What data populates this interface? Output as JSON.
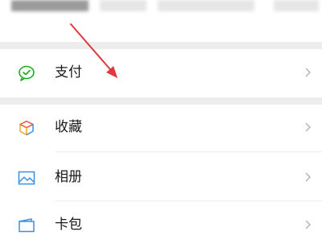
{
  "menu": {
    "items": [
      {
        "label": "支付",
        "icon": "wechat-pay-icon",
        "icon_color": "#1aad19"
      },
      {
        "label": "收藏",
        "icon": "favorites-cube-icon",
        "icon_colors": [
          "#f5a623",
          "#e84c3d",
          "#3b8ee6"
        ]
      },
      {
        "label": "相册",
        "icon": "album-image-icon",
        "icon_color": "#3b8ee6"
      },
      {
        "label": "卡包",
        "icon": "card-wallet-icon",
        "icon_color": "#3b8ee6"
      }
    ],
    "chevron": "chevron-right-icon"
  },
  "annotation": {
    "color": "#e0393e"
  }
}
